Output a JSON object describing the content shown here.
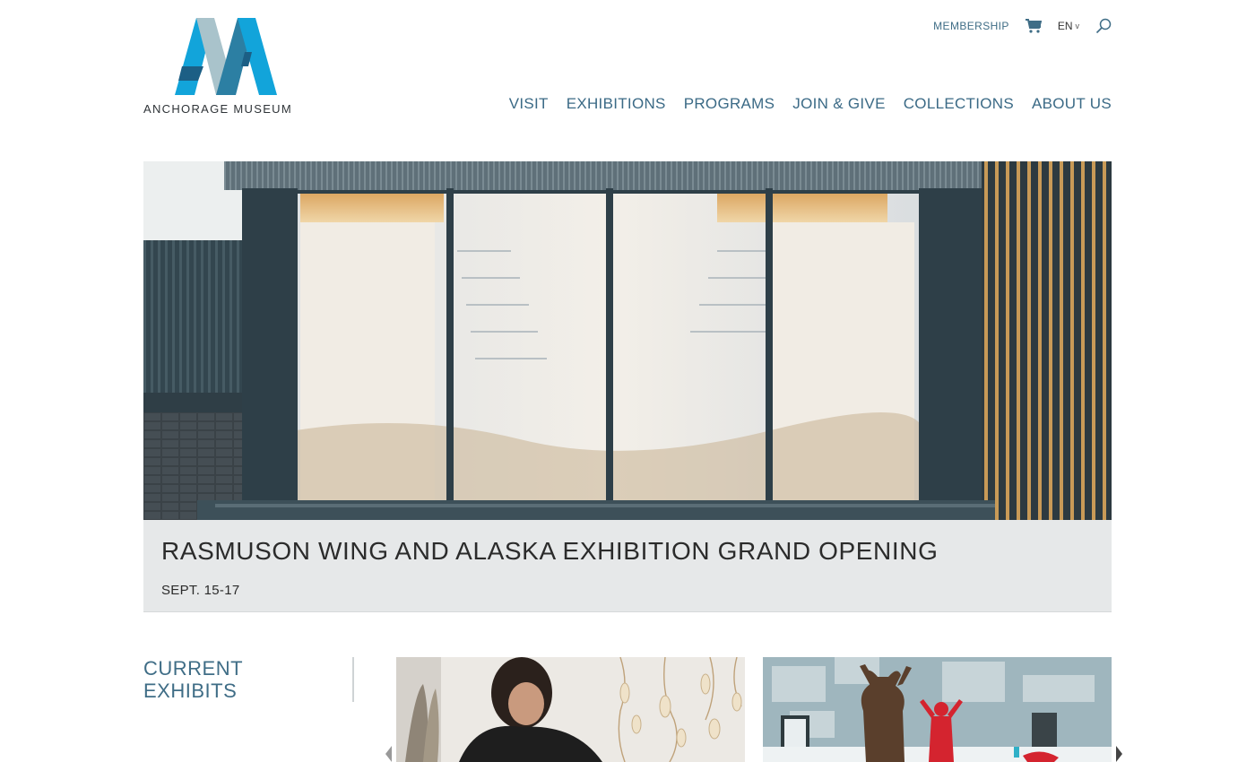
{
  "logo": {
    "name": "ANCHORAGE MUSEUM",
    "icon": "anchorage-museum-logo-mark",
    "colors": [
      "#12a4da",
      "#2c7fa3",
      "#a9c3cb",
      "#1c5f85"
    ]
  },
  "utility_nav": {
    "membership": "MEMBERSHIP",
    "cart_icon": "cart-icon",
    "language": "EN",
    "language_caret": "v",
    "search_icon": "search-icon"
  },
  "main_nav": [
    "VISIT",
    "EXHIBITIONS",
    "PROGRAMS",
    "JOIN & GIVE",
    "COLLECTIONS",
    "ABOUT US"
  ],
  "hero": {
    "image": "museum-building-facade-photo",
    "title": "RASMUSON WING AND ALASKA EXHIBITION GRAND OPENING",
    "date": "SEPT. 15-17"
  },
  "current_exhibits": {
    "heading_line1": "CURRENT",
    "heading_line2": "EXHIBITS",
    "items": [
      {
        "image": "artist-with-hanging-sculptures-photo"
      },
      {
        "image": "bear-and-performer-in-red-photo"
      }
    ]
  },
  "colors": {
    "accent": "#3f6d86",
    "caption_bg": "#e6e8e9",
    "text_dark": "#2b2b2b"
  }
}
